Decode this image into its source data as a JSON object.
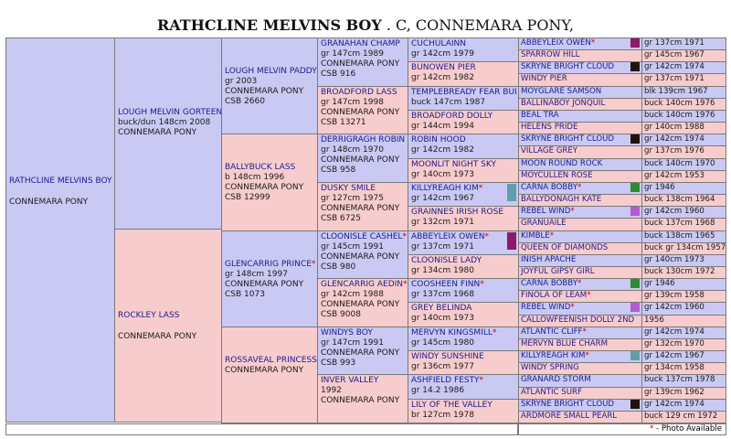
{
  "title": {
    "name": "RATHCLINE MELVINS BOY",
    "rest": " . C, CONNEMARA PONY,"
  },
  "footer": {
    "star": "*",
    "text": " - Photo Available"
  },
  "colors": {
    "male": "#c9c9f3",
    "female": "#f7cccd"
  },
  "subject": {
    "name": "RATHCLINE MELVINS BOY",
    "breed": "CONNEMARA PONY"
  },
  "sire": {
    "name": "LOUGH MELVIN GORTEEN",
    "l1": "buck/dun 148cm 2008",
    "l2": "CONNEMARA PONY"
  },
  "dam": {
    "name": "Rockley Lass",
    "breed": "CONNEMARA PONY"
  },
  "g2": [
    {
      "name": "LOUGH MELVIN PADDY",
      "l1": "gr 2003",
      "l2": "CONNEMARA PONY",
      "l3": "CSB 2660"
    },
    {
      "name": "BALLYBUCK LASS",
      "l1": "b 148cm 1996",
      "l2": "CONNEMARA PONY",
      "l3": "CSB 12999"
    },
    {
      "name": "GLENCARRIG PRINCE",
      "star": "*",
      "l1": "gr 148cm 1997",
      "l2": "CONNEMARA PONY",
      "l3": "CSB 1073"
    },
    {
      "name": "ROSSAVEAL PRINCESS",
      "l1": "",
      "l2": "CONNEMARA PONY",
      "l3": ""
    }
  ],
  "g3": [
    {
      "name": "GRANAHAN CHAMP",
      "l1": "gr 147cm 1989",
      "l2": "CONNEMARA PONY",
      "l3": "CSB 916"
    },
    {
      "name": "BROADFORD LASS",
      "l1": "gr 147cm 1998",
      "l2": "CONNEMARA PONY",
      "l3": "CSB 13271"
    },
    {
      "name": "DERRIGRAGH ROBIN",
      "l1": "gr 148cm 1970",
      "l2": "CONNEMARA PONY",
      "l3": "CSB 958"
    },
    {
      "name": "DUSKY SMILE",
      "l1": "gr 127cm 1975",
      "l2": "CONNEMARA PONY",
      "l3": "CSB 6725"
    },
    {
      "name": "CLOONISLE CASHEL",
      "star": "*",
      "l1": "gr 145cm 1991",
      "l2": "CONNEMARA PONY",
      "l3": "CSB 980"
    },
    {
      "name": "GLENCARRIG AEDIN",
      "star": "*",
      "l1": "gr 142cm 1988",
      "l2": "CONNEMARA PONY",
      "l3": "CSB 9008"
    },
    {
      "name": "WINDYS BOY",
      "l1": "gr 147cm 1991",
      "l2": "CONNEMARA PONY",
      "l3": "CSB 993"
    },
    {
      "name": "INVER VALLEY",
      "l1": "1992",
      "l2": "CONNEMARA PONY",
      "l3": ""
    }
  ],
  "g4": [
    {
      "name": "CUCHULAINN",
      "l1": "gr 142cm 1979"
    },
    {
      "name": "BUNOWEN PIER",
      "l1": "gr 142cm 1982"
    },
    {
      "name": "TEMPLEBREADY FEAR BUI",
      "l1": "buck 147cm 1987"
    },
    {
      "name": "BROADFORD DOLLY",
      "l1": "gr 144cm 1994"
    },
    {
      "name": "ROBIN HOOD",
      "l1": "gr 142cm 1982"
    },
    {
      "name": "MOONLIT NIGHT SKY",
      "l1": "gr 140cm 1973"
    },
    {
      "name": "KILLYREAGH KIM",
      "star": "*",
      "l1": "gr 142cm 1967"
    },
    {
      "name": "GRAINNES IRISH ROSE",
      "l1": "gr 132cm 1971"
    },
    {
      "name": "ABBEYLEIX OWEN",
      "star": "*",
      "l1": "gr 137cm 1971"
    },
    {
      "name": "CLOONISLE LADY",
      "l1": "gr 134cm 1980"
    },
    {
      "name": "COOSHEEN FINN",
      "star": "*",
      "l1": "gr 137cm 1968"
    },
    {
      "name": "GREY BELINDA",
      "l1": "gr 140cm 1973"
    },
    {
      "name": "MERVYN KINGSMILL",
      "star": "*",
      "l1": "gr 145cm 1980"
    },
    {
      "name": "WINDY SUNSHINE",
      "l1": "gr 136cm 1977"
    },
    {
      "name": "ASHFIELD FESTY",
      "star": "*",
      "l1": "gr 14.2 1986"
    },
    {
      "name": "LILY OF THE VALLEY",
      "l1": "br 127cm 1978"
    }
  ],
  "g5": [
    {
      "name": "ABBEYLEIX OWEN",
      "star": "*",
      "info": "gr 137cm 1971",
      "sq": "#8b1a6b"
    },
    {
      "name": "SPARROW HILL",
      "info": "gr 145cm 1967"
    },
    {
      "name": "SKRYNE BRIGHT CLOUD",
      "info": "gr 142cm 1974",
      "sq": "#1e130d"
    },
    {
      "name": "WINDY PIER",
      "info": "gr 137cm 1971"
    },
    {
      "name": "MOYGLARE SAMSON",
      "info": "blk 139cm 1967"
    },
    {
      "name": "BALLINABOY JONQUIL",
      "info": "buck 140cm 1976"
    },
    {
      "name": "BEAL TRA",
      "info": "buck 140cm 1976"
    },
    {
      "name": "HELENS PRIDE",
      "info": "gr 140cm 1988"
    },
    {
      "name": "SKRYNE BRIGHT CLOUD",
      "info": "gr 142cm 1974",
      "sq": "#1e130d"
    },
    {
      "name": "VILLAGE GREY",
      "info": "gr 137cm 1976"
    },
    {
      "name": "MOON ROUND ROCK",
      "info": "buck 140cm 1970"
    },
    {
      "name": "MOYCULLEN ROSE",
      "info": "gr 142cm 1953"
    },
    {
      "name": "CARNA BOBBY",
      "star": "*",
      "info": "gr 1946",
      "sq": "#2e8b2e"
    },
    {
      "name": "BALLYDONAGH KATE",
      "info": "buck 138cm 1964"
    },
    {
      "name": "REBEL WIND",
      "star": "*",
      "info": "gr 142cm 1960",
      "sq": "#b45bd3"
    },
    {
      "name": "GRANUAILE",
      "info": "buck 137cm 1968"
    },
    {
      "name": "KIMBLE",
      "star": "*",
      "info": "buck 138cm 1965"
    },
    {
      "name": "QUEEN OF DIAMONDS",
      "info": "buck gr 134cm 1957"
    },
    {
      "name": "INISH APACHE",
      "info": "gr 140cm 1973"
    },
    {
      "name": "JOYFUL GIPSY GIRL",
      "info": "buck 130cm 1972"
    },
    {
      "name": "CARNA BOBBY",
      "star": "*",
      "info": "gr 1946",
      "sq": "#2e8b2e"
    },
    {
      "name": "FINOLA OF LEAM",
      "star": "*",
      "info": "gr 139cm 1958"
    },
    {
      "name": "REBEL WIND",
      "star": "*",
      "info": "gr 142cm 1960",
      "sq": "#b45bd3"
    },
    {
      "name": "CALLOWFEENISH DOLLY 2ND",
      "info": "1956"
    },
    {
      "name": "ATLANTIC CLIFF",
      "star": "*",
      "info": "gr 142cm 1974"
    },
    {
      "name": "MERVYN BLUE CHARM",
      "info": "gr 132cm 1970"
    },
    {
      "name": "KILLYREAGH KIM",
      "star": "*",
      "info": "gr 142cm 1967",
      "sq": "#5fa0a8"
    },
    {
      "name": "WINDY SPRING",
      "info": "gr 134cm 1958"
    },
    {
      "name": "GRANARD STORM",
      "info": "buck 137cm 1978"
    },
    {
      "name": "ATLANTIC SURF",
      "info": "gr 139cm 1962"
    },
    {
      "name": "SKRYNE BRIGHT CLOUD",
      "info": "gr 142cm 1974",
      "sq": "#1e130d"
    },
    {
      "name": "ARDMORE SMALL PEARL",
      "info": "buck 129 cm 1972"
    }
  ],
  "g4_squares": {
    "6": "#5fa0a8",
    "8": "#8b1a6b"
  }
}
